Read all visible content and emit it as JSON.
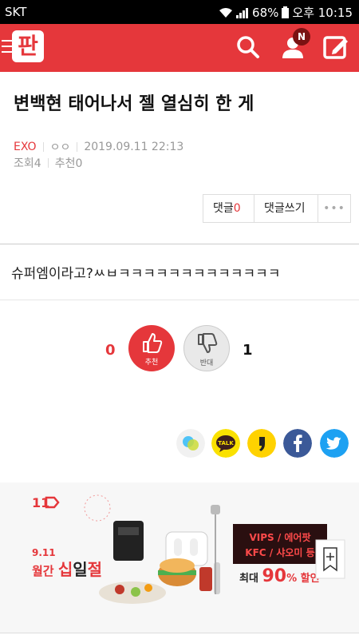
{
  "status": {
    "carrier": "SKT",
    "battery": "68%",
    "time": "오후 10:15"
  },
  "appbar": {
    "logo": "판",
    "badge": "N"
  },
  "post": {
    "title": "변백현 태어나서 젤 열심히 한 게",
    "category": "EXO",
    "author": "ㅇㅇ",
    "datetime": "2019.09.11 22:13",
    "views_label": "조회",
    "views": "4",
    "recommend_label": "추천",
    "recommend": "0",
    "content": "슈퍼엠이라고?ㅆㅂㅋㅋㅋㅋㅋㅋㅋㅋㅋㅋㅋㅋㅋ"
  },
  "comments": {
    "label": "댓글",
    "count": "0",
    "write": "댓글쓰기",
    "more": "•••"
  },
  "vote": {
    "up_count": "0",
    "up_label": "추천",
    "down_label": "반대",
    "down_count": "1"
  },
  "banner": {
    "brand": "11",
    "date": "9.11",
    "event_left": "월간 ",
    "event_a": "십",
    "event_b": "일",
    "event_c": "절",
    "brands_line1": "VIPS / 에어팟",
    "brands_line2": "KFC / 샤오미 등",
    "discount_prefix": "최대 ",
    "discount": "90",
    "discount_suffix": "% 할인"
  },
  "colors": {
    "accent": "#e5373b",
    "kakao_yellow": "#fae100",
    "facebook": "#3b5998",
    "twitter": "#1da1f2"
  }
}
